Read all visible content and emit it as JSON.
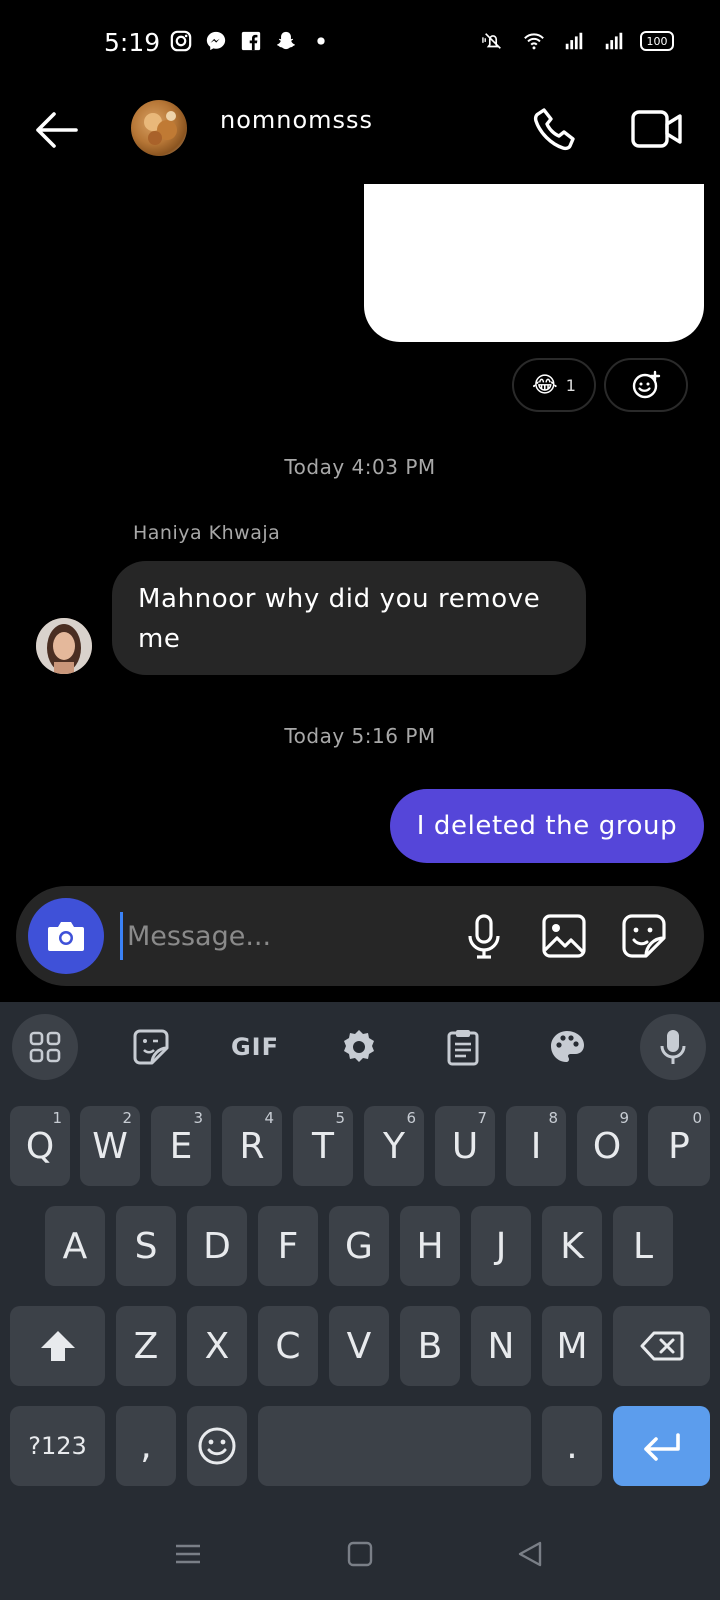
{
  "status_bar": {
    "time": "5:19",
    "battery": "100",
    "left_icons": [
      "instagram-icon",
      "messenger-icon",
      "facebook-icon",
      "snapchat-icon",
      "dot-icon"
    ],
    "right_icons": [
      "mute-vibrate-icon",
      "wifi-icon",
      "signal-icon",
      "signal-icon",
      "battery-icon"
    ]
  },
  "header": {
    "title": "nomnomsss",
    "back_icon": "arrow-left-icon",
    "call_icon": "phone-icon",
    "video_icon": "video-camera-icon"
  },
  "messages": {
    "reaction": {
      "emoji": "😂",
      "count": "1",
      "add_icon": "add-reaction-icon"
    },
    "timestamp_1": "Today 4:03 PM",
    "incoming": {
      "sender": "Haniya Khwaja",
      "text": "Mahnoor why did you remove me"
    },
    "timestamp_2": "Today 5:16 PM",
    "outgoing": {
      "text": "I deleted the group"
    }
  },
  "composer": {
    "placeholder": "Message...",
    "value": "",
    "accent": "#3f51d8"
  },
  "keyboard": {
    "toolbar": {
      "gif_label": "GIF",
      "items": [
        "apps-grid-icon",
        "sticker-icon",
        "gif",
        "settings-icon",
        "clipboard-icon",
        "palette-icon",
        "mic-icon"
      ]
    },
    "row1": [
      {
        "label": "Q",
        "hint": "1"
      },
      {
        "label": "W",
        "hint": "2"
      },
      {
        "label": "E",
        "hint": "3"
      },
      {
        "label": "R",
        "hint": "4"
      },
      {
        "label": "T",
        "hint": "5"
      },
      {
        "label": "Y",
        "hint": "6"
      },
      {
        "label": "U",
        "hint": "7"
      },
      {
        "label": "I",
        "hint": "8"
      },
      {
        "label": "O",
        "hint": "9"
      },
      {
        "label": "P",
        "hint": "0"
      }
    ],
    "row2": [
      "A",
      "S",
      "D",
      "F",
      "G",
      "H",
      "J",
      "K",
      "L"
    ],
    "row3": [
      "Z",
      "X",
      "C",
      "V",
      "B",
      "N",
      "M"
    ],
    "symbols_label": "?123",
    "comma_label": ",",
    "period_label": ".",
    "enter_color": "#5c9ded"
  },
  "navbar": {
    "items": [
      "menu-icon",
      "home-square-icon",
      "back-triangle-icon"
    ]
  }
}
